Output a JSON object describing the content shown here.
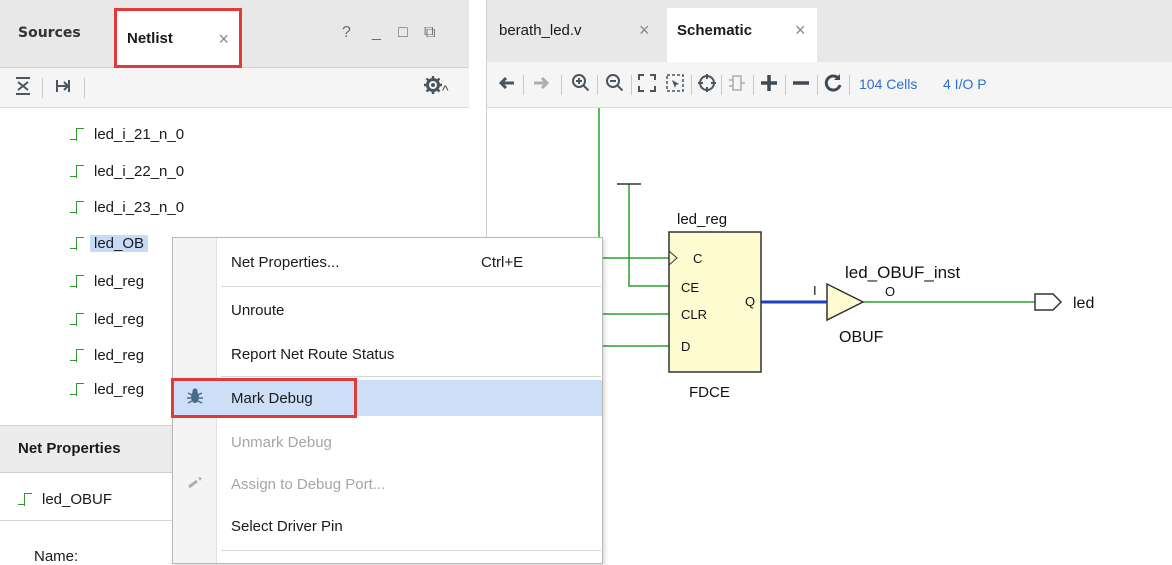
{
  "left_panel": {
    "tabs": [
      {
        "label": "Sources",
        "active": false
      },
      {
        "label": "Netlist",
        "active": true
      }
    ],
    "window_controls": [
      "?",
      "_",
      "□",
      "⧉"
    ],
    "toolbar_icons": [
      "collapse-all-icon",
      "expand-all-icon",
      "gear-icon"
    ],
    "tree_items": [
      {
        "label": "led_i_21_n_0"
      },
      {
        "label": "led_i_22_n_0"
      },
      {
        "label": "led_i_23_n_0"
      },
      {
        "label": "led_OB",
        "selected": true
      },
      {
        "label": "led_reg"
      },
      {
        "label": "led_reg"
      },
      {
        "label": "led_reg"
      },
      {
        "label": "led_reg"
      }
    ],
    "net_properties": {
      "title": "Net Properties",
      "item": "led_OBUF",
      "name_label": "Name:"
    }
  },
  "right_panel": {
    "tabs": [
      {
        "label": "berath_led.v",
        "active": false
      },
      {
        "label": "Schematic",
        "active": true
      }
    ],
    "toolbar": {
      "icons": [
        "back-arrow-icon",
        "forward-arrow-icon",
        "zoom-in-icon",
        "zoom-out-icon",
        "fit-icon",
        "zoom-area-icon",
        "crosshair-icon",
        "split-icon",
        "plus-icon",
        "minus-icon",
        "refresh-icon"
      ],
      "cells_label": "104 Cells",
      "io_label": "4 I/O P"
    },
    "schematic": {
      "reg_instance": "led_reg",
      "reg_type": "FDCE",
      "reg_pins": [
        "C",
        "CE",
        "CLR",
        "D"
      ],
      "reg_out": "Q",
      "buf_instance": "led_OBUF_inst",
      "buf_type": "OBUF",
      "buf_in": "I",
      "buf_out": "O",
      "port_name": "led",
      "colors": {
        "wire": "#2aa02a",
        "highlight": "#1f3fbf",
        "cell_fill": "#fffbd0"
      }
    }
  },
  "context_menu": {
    "items": [
      {
        "label": "Net Properties...",
        "shortcut": "Ctrl+E",
        "enabled": true
      },
      {
        "label": "Unroute",
        "enabled": true
      },
      {
        "label": "Report Net Route Status",
        "enabled": true
      },
      {
        "label": "Mark Debug",
        "enabled": true,
        "highlighted": true,
        "icon": "bug-icon"
      },
      {
        "label": "Unmark Debug",
        "enabled": false
      },
      {
        "label": "Assign to Debug Port...",
        "enabled": false,
        "icon": "assign-port-icon"
      },
      {
        "label": "Select Driver Pin",
        "enabled": true
      }
    ]
  }
}
